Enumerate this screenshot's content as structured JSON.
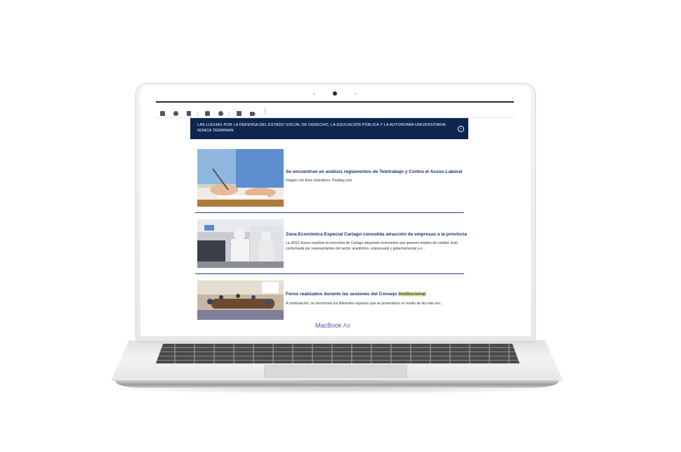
{
  "device": {
    "brand_main": "MacBook",
    "brand_model": "Air"
  },
  "toolbar": {
    "icons": [
      "archive-icon",
      "report-icon",
      "delete-icon",
      "mark-unread-icon",
      "snooze-icon",
      "add-to-tasks-icon",
      "label-icon",
      "more-options-icon"
    ]
  },
  "banner": {
    "text": "LAS LUCHAS POR LA DEFENSA DEL ESTADO SOCIAL DE DERECHO, LA EDUCACIÓN PÚBLICA Y LA AUTONOMÍA UNIVERSITARIA NUNCA TERMINAN",
    "bg_color": "#0d2650"
  },
  "articles": [
    {
      "title": "Se encuentran en análisis reglamentos de Teletrabajo y Contra el Acoso Laboral",
      "description": "Imagen con fines ilustrativos. Pixabay.com"
    },
    {
      "title": "Zona Económica Especial Cartago consolida atracción de empresas a la provincia",
      "description": "La ZEEC busca reactivar la economía de Cartago atrayendo inversiones que generen empleo de calidad. Está conformada por representantes del sector académico, empresarial y gubernamental y e..."
    },
    {
      "title_before": "Foros realizados durante las sesiones del Consejo ",
      "title_highlight": "Institucional",
      "description": "A continuación, se mencionan los diferentes espacios que se presentaron en medio de las más reci..."
    }
  ],
  "colors": {
    "title": "#14356b",
    "divider": "#1f3f7a",
    "highlight": "#f3ec9c"
  }
}
